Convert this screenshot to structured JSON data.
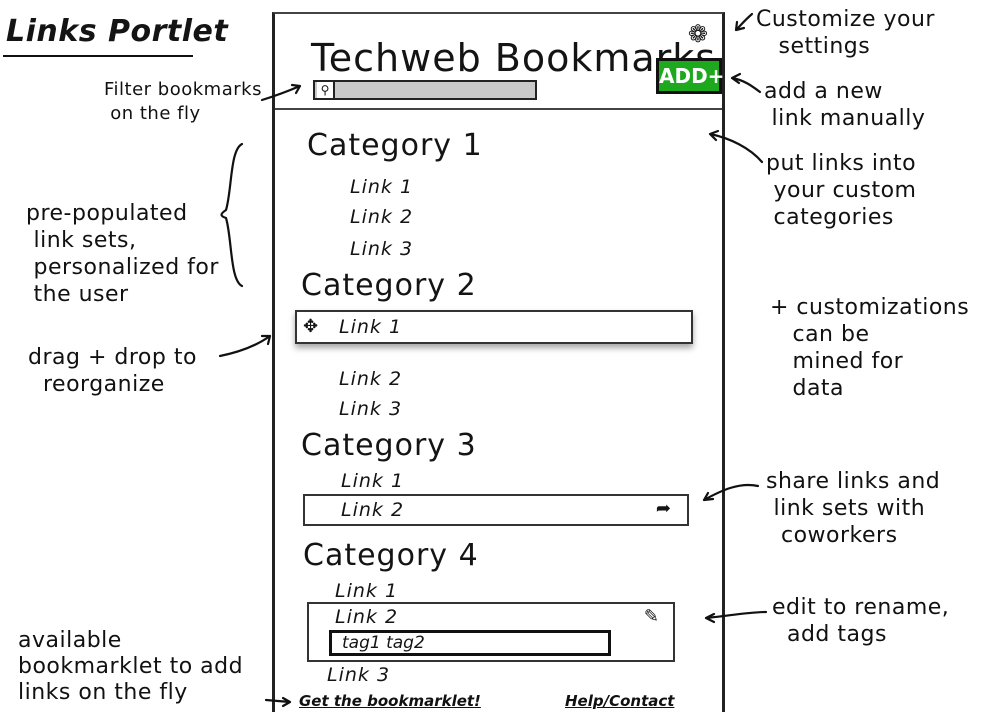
{
  "page_title": "Links Portlet",
  "portlet": {
    "title": "Techweb Bookmarks",
    "add_button_label": "ADD+",
    "gear_icon": "gear-icon",
    "search_icon": "search-icon",
    "categories": [
      {
        "name": "Category 1",
        "links": [
          "Link 1",
          "Link 2",
          "Link 3"
        ]
      },
      {
        "name": "Category 2",
        "links": [
          "Link 1",
          "Link 2",
          "Link 3"
        ]
      },
      {
        "name": "Category 3",
        "links": [
          "Link 1",
          "Link 2"
        ]
      },
      {
        "name": "Category 4",
        "links": [
          "Link 1",
          "Link 2",
          "Link 3"
        ]
      }
    ],
    "tags_value": "tag1  tag2",
    "footer": {
      "bookmarklet": "Get the bookmarklet!",
      "help": "Help/Contact"
    }
  },
  "annotations": {
    "customize": "Customize your\n   settings",
    "add_link": "add a new\n link manually",
    "filter": "Filter bookmarks\n on the fly",
    "categories": "put links into\n your custom\n categories",
    "prepopulated": "pre-populated\n link sets,\n personalized for\n the user",
    "mining": "+ customizations\n   can be\n   mined for\n   data",
    "drag": "drag + drop to\n  reorganize",
    "share": "share links and\n link sets with\n  coworkers",
    "edit": "edit to rename,\n  add tags",
    "bookmarklet": "available\nbookmarklet to add\nlinks on the fly"
  }
}
